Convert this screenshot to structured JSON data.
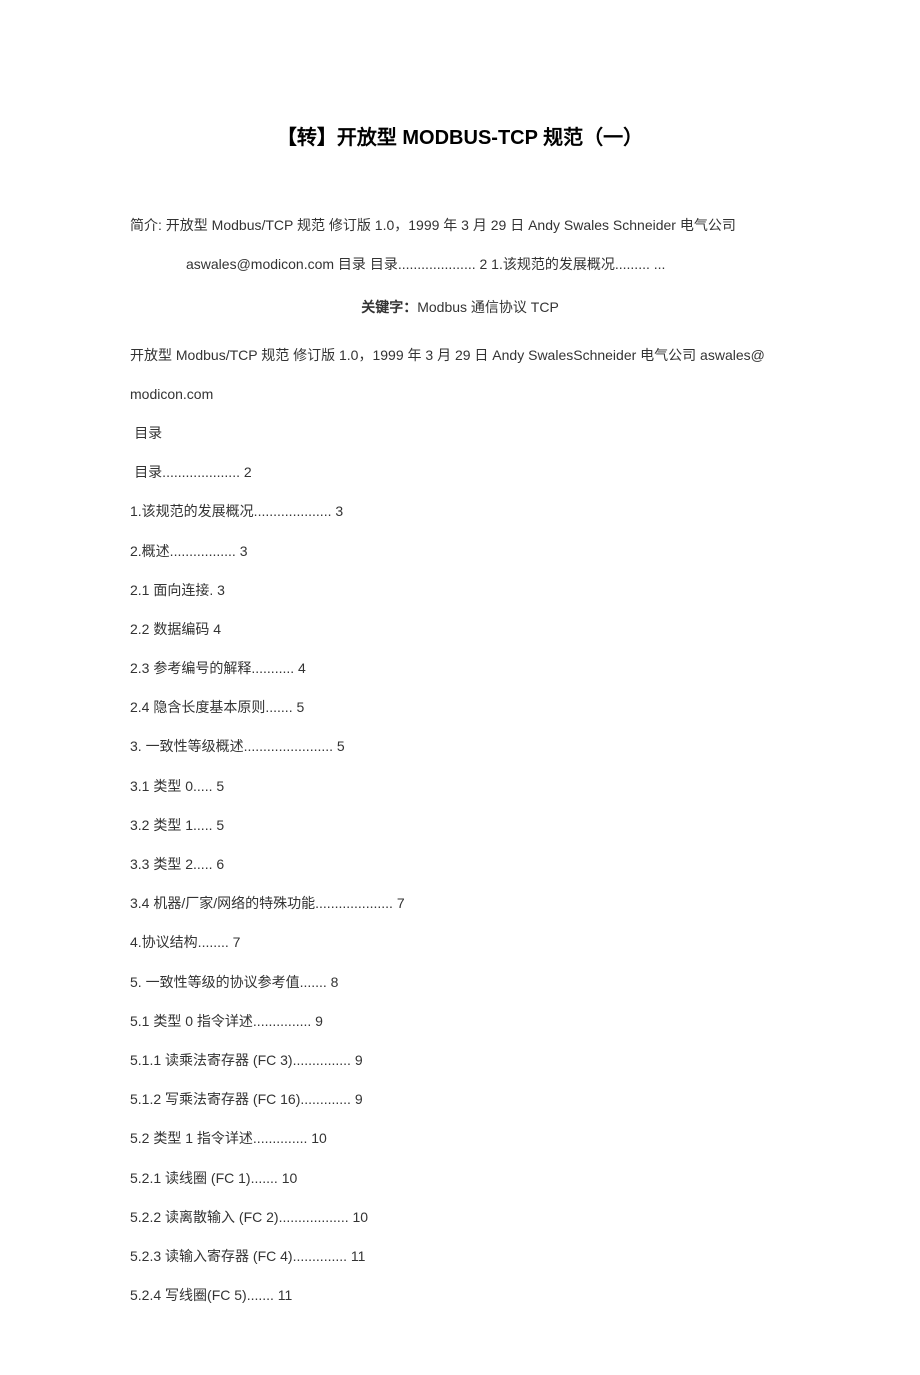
{
  "title": "【转】开放型 MODBUS-TCP 规范（一）",
  "intro": {
    "line1": "简介: 开放型 Modbus/TCP 规范 修订版 1.0，1999 年 3 月 29 日 Andy Swales Schneider 电气公司",
    "line2": "aswales@modicon.com  目录  目录.................... 2 1.该规范的发展概况.........  ..."
  },
  "keywords_label": "关键字：",
  "keywords_value": "Modbus 通信协议 TCP",
  "header_lines": [
    "开放型 Modbus/TCP 规范 修订版 1.0，1999 年 3 月 29 日 Andy SwalesSchneider 电气公司 aswales@",
    "modicon.com"
  ],
  "toc_top": [
    " 目录",
    " 目录.................... 2",
    "1.该规范的发展概况.................... 3",
    "2.概述................. 3",
    "2.1 面向连接. 3",
    "2.2 数据编码 4",
    "2.3 参考编号的解释........... 4",
    "2.4 隐含长度基本原则....... 5",
    "3. 一致性等级概述....................... 5",
    "3.1 类型 0..... 5",
    "3.2 类型 1..... 5",
    "3.3 类型 2..... 6",
    "3.4 机器/厂家/网络的特殊功能.................... 7",
    "4.协议结构........ 7",
    "5. 一致性等级的协议参考值....... 8",
    "5.1 类型 0 指令详述............... 9",
    "5.1.1 读乘法寄存器 (FC 3)............... 9",
    "5.1.2 写乘法寄存器 (FC 16)............. 9",
    "5.2 类型 1 指令详述.............. 10",
    "5.2.1 读线圈 (FC 1)....... 10",
    "5.2.2 读离散输入 (FC 2).................. 10",
    "5.2.3 读输入寄存器 (FC 4).............. 11",
    "5.2.4 写线圈(FC 5)....... 11"
  ]
}
